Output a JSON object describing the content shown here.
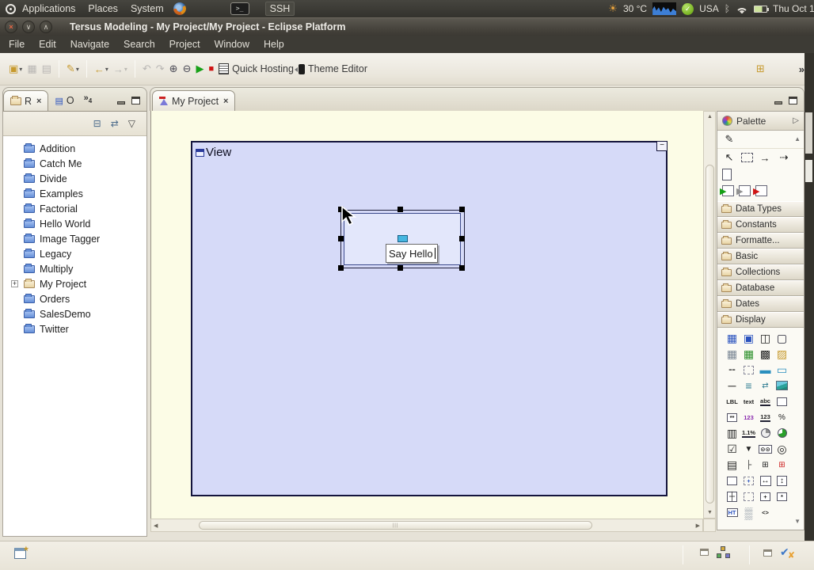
{
  "desktop_bar": {
    "menus": [
      "Applications",
      "Places",
      "System"
    ],
    "terminal_glyph": ">_",
    "ssh_label": "SSH",
    "temperature": "30 °C",
    "layout": "USA",
    "clock": "Thu Oct 1",
    "badge_glyph": "✓"
  },
  "titlebar": {
    "title": "Tersus Modeling - My Project/My Project - Eclipse Platform",
    "close_glyph": "×",
    "min_glyph": "∨",
    "max_glyph": "∧"
  },
  "menubar": {
    "items": [
      "File",
      "Edit",
      "Navigate",
      "Search",
      "Project",
      "Window",
      "Help"
    ]
  },
  "toolbar": {
    "quick_hosting": "Quick Hosting",
    "theme_editor": "Theme Editor",
    "overflow": "»"
  },
  "glyphs": {
    "sun": "☀",
    "bluetooth": "ᛒ",
    "new_wizard": "▣",
    "dropdown": "▾",
    "save": "▦",
    "print": "▤",
    "pen": "✎",
    "back": "←",
    "forward": "→",
    "undo": "↶",
    "redo": "↷",
    "zoom_in": "⊕",
    "zoom_out": "⊖",
    "play": "▶",
    "stop": "■",
    "new_table": "⊞",
    "collapse_all": "⊟",
    "link_editor": "⇄",
    "view_menu": "▽",
    "outline_tab": "▤",
    "scroll_up": "▲",
    "scroll_down": "▼",
    "scroll_left": "◀",
    "scroll_right": "▶",
    "hthumb_grip": "|||",
    "fastview_star": "★",
    "check": "✔",
    "cross": "✘",
    "edge_dots": ":",
    "tab_close": "×"
  },
  "explorer": {
    "tab_r": "R",
    "tab_o": "O",
    "more_views": "»",
    "more_count": "4",
    "tree": [
      {
        "label": "Addition",
        "icon": "closed",
        "expander": ""
      },
      {
        "label": "Catch Me",
        "icon": "closed",
        "expander": ""
      },
      {
        "label": "Divide",
        "icon": "closed",
        "expander": ""
      },
      {
        "label": "Examples",
        "icon": "closed",
        "expander": ""
      },
      {
        "label": "Factorial",
        "icon": "closed",
        "expander": ""
      },
      {
        "label": "Hello World",
        "icon": "closed",
        "expander": ""
      },
      {
        "label": "Image Tagger",
        "icon": "closed",
        "expander": ""
      },
      {
        "label": "Legacy",
        "icon": "closed",
        "expander": ""
      },
      {
        "label": "Multiply",
        "icon": "closed",
        "expander": ""
      },
      {
        "label": "My Project",
        "icon": "open",
        "expander": "+"
      },
      {
        "label": "Orders",
        "icon": "closed",
        "expander": ""
      },
      {
        "label": "SalesDemo",
        "icon": "closed",
        "expander": ""
      },
      {
        "label": "Twitter",
        "icon": "closed",
        "expander": ""
      }
    ]
  },
  "editor": {
    "tab": "My Project",
    "view_label": "View",
    "collapse_glyph": "−",
    "say_hello": "Say Hello"
  },
  "palette": {
    "title": "Palette",
    "pin_glyph": "▷",
    "connection_glyph": "✎",
    "tools": [
      {
        "name": "select-tool",
        "glyph": "↖",
        "cls": ""
      },
      {
        "name": "marquee-tool",
        "glyph": "",
        "cls": "marquee"
      },
      {
        "name": "flow-arrow-tool",
        "glyph": "→",
        "cls": ""
      },
      {
        "name": "dashed-flow-arrow-tool",
        "glyph": "⇢",
        "cls": ""
      }
    ],
    "creation_tools": [
      {
        "name": "display-flag-tool",
        "glyph": "▶",
        "cls": "green"
      },
      {
        "name": "process-flag-tool",
        "glyph": "▶",
        "cls": "gray"
      },
      {
        "name": "system-flag-tool",
        "glyph": "▶",
        "cls": "red"
      }
    ],
    "drawers": [
      "Data Types",
      "Constants",
      "Formatte...",
      "Basic",
      "Collections",
      "Database",
      "Dates",
      "Display"
    ],
    "display_icons": [
      {
        "name": "calendar-icon",
        "glyph": "▦",
        "cls": "cblue big"
      },
      {
        "name": "window-icon",
        "glyph": "▣",
        "cls": "cblue big"
      },
      {
        "name": "pane-icon",
        "glyph": "◫",
        "cls": "cdark big"
      },
      {
        "name": "group-box-icon",
        "glyph": "▢",
        "cls": "cnavy big"
      },
      {
        "name": "grid-icon",
        "glyph": "▦",
        "cls": "cgray big"
      },
      {
        "name": "table-icon",
        "glyph": "▦",
        "cls": "cgreen big"
      },
      {
        "name": "dark-table-icon",
        "glyph": "▩",
        "cls": "cdark big"
      },
      {
        "name": "image-table-icon",
        "glyph": "▨",
        "cls": "cgold big"
      },
      {
        "name": "row-icon",
        "glyph": "╌",
        "cls": "cdark big"
      },
      {
        "name": "dashed-box-icon",
        "glyph": "",
        "cls": "dashedbox"
      },
      {
        "name": "field-icon",
        "glyph": "▬",
        "cls": "ccyan big"
      },
      {
        "name": "labeled-field-icon",
        "glyph": "▭",
        "cls": "ccyan big"
      },
      {
        "name": "separator-icon",
        "glyph": "─",
        "cls": "cdark big"
      },
      {
        "name": "text-lines-icon",
        "glyph": "≡",
        "cls": "cteal big"
      },
      {
        "name": "show-link-icon",
        "glyph": "⇄",
        "cls": "cteal"
      },
      {
        "name": "image-icon",
        "glyph": "",
        "cls": "imgfill"
      },
      {
        "name": "label-icon",
        "glyph": "LBL",
        "cls": "cdark txt"
      },
      {
        "name": "text-icon",
        "glyph": "text",
        "cls": "cdark txt"
      },
      {
        "name": "text-input-icon",
        "glyph": "abc",
        "cls": "cdark txt und"
      },
      {
        "name": "text-area-icon",
        "glyph": "",
        "cls": "whitebox"
      },
      {
        "name": "password-icon",
        "glyph": "**",
        "cls": "cdark txt box"
      },
      {
        "name": "styled-number-icon",
        "glyph": "123",
        "cls": "cpurple txt"
      },
      {
        "name": "number-input-icon",
        "glyph": "123",
        "cls": "cdark txt und"
      },
      {
        "name": "percent-icon",
        "glyph": "%",
        "cls": "cdark"
      },
      {
        "name": "pagination-icon",
        "glyph": "▥",
        "cls": "cdark big"
      },
      {
        "name": "decimal-input-icon",
        "glyph": "1.1%",
        "cls": "cdark txt und"
      },
      {
        "name": "clock-icon",
        "glyph": "",
        "cls": "pie gray"
      },
      {
        "name": "pie-chart-icon",
        "glyph": "",
        "cls": "pie green"
      },
      {
        "name": "checkbox-icon",
        "glyph": "☑",
        "cls": "cdark big"
      },
      {
        "name": "dropdown-icon",
        "glyph": "▼",
        "cls": "cdark"
      },
      {
        "name": "radio-group-icon",
        "glyph": "⊙⊙",
        "cls": "cdark txt box"
      },
      {
        "name": "spinner-icon",
        "glyph": "◎",
        "cls": "cdark big"
      },
      {
        "name": "rich-text-icon",
        "glyph": "▤",
        "cls": "cdark big"
      },
      {
        "name": "tree-item-icon",
        "glyph": "├",
        "cls": "cdark"
      },
      {
        "name": "tree-icon",
        "glyph": "⊞",
        "cls": "cdark"
      },
      {
        "name": "tree-selected-icon",
        "glyph": "⊞",
        "cls": "cred"
      },
      {
        "name": "panel-icon",
        "glyph": "",
        "cls": "whitebox"
      },
      {
        "name": "center-layout-icon",
        "glyph": "+",
        "cls": "cblue dashedbox txt"
      },
      {
        "name": "hresize-icon",
        "glyph": "↔",
        "cls": "cdark box"
      },
      {
        "name": "vresize-icon",
        "glyph": "↕",
        "cls": "cdark box"
      },
      {
        "name": "split-icon",
        "glyph": "┼",
        "cls": "cdark box"
      },
      {
        "name": "placeholder-icon",
        "glyph": "",
        "cls": "dashedbox"
      },
      {
        "name": "plus-box-icon",
        "glyph": "+",
        "cls": "cdark box txt"
      },
      {
        "name": "asterisk-box-icon",
        "glyph": "*",
        "cls": "cdark box txt"
      },
      {
        "name": "html-icon",
        "glyph": "HT",
        "cls": "cblue txt box"
      },
      {
        "name": "dotted-grid-icon",
        "glyph": "▒",
        "cls": "cgray big"
      },
      {
        "name": "angle-brackets-icon",
        "glyph": "<>",
        "cls": "cdark txt"
      }
    ]
  },
  "colors": {
    "canvas": "#fcfce6",
    "view_fill": "#d6daf8",
    "run_green": "#18a118",
    "stop_red": "#cf1212"
  }
}
